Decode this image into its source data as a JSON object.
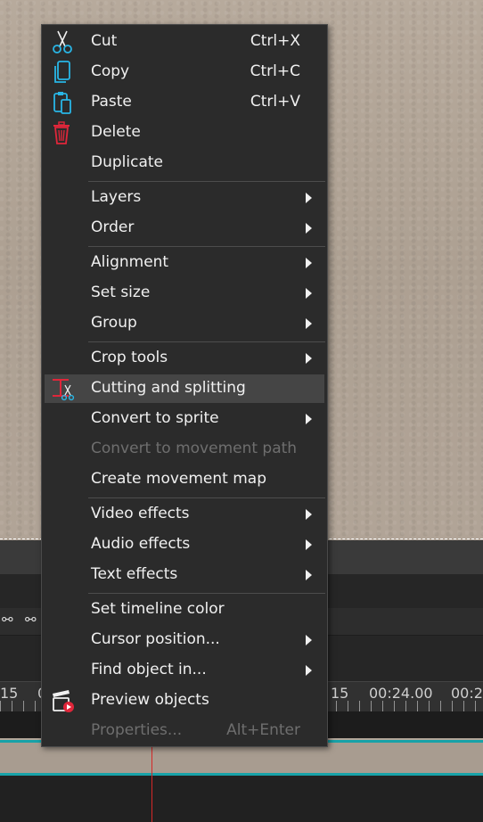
{
  "menu": {
    "items": [
      {
        "label": "Cut",
        "shortcut": "Ctrl+X",
        "icon": "scissors-icon"
      },
      {
        "label": "Copy",
        "shortcut": "Ctrl+C",
        "icon": "copy-icon"
      },
      {
        "label": "Paste",
        "shortcut": "Ctrl+V",
        "icon": "paste-icon"
      },
      {
        "label": "Delete",
        "icon": "trash-icon"
      },
      {
        "label": "Duplicate"
      },
      {
        "label": "Layers",
        "submenu": true
      },
      {
        "label": "Order",
        "submenu": true
      },
      {
        "label": "Alignment",
        "submenu": true
      },
      {
        "label": "Set size",
        "submenu": true
      },
      {
        "label": "Group",
        "submenu": true
      },
      {
        "label": "Crop tools",
        "submenu": true
      },
      {
        "label": "Cutting and splitting",
        "icon": "cut-split-icon",
        "highlighted": true
      },
      {
        "label": "Convert to sprite",
        "submenu": true
      },
      {
        "label": "Convert to movement path",
        "disabled": true
      },
      {
        "label": "Create movement map"
      },
      {
        "label": "Video effects",
        "submenu": true
      },
      {
        "label": "Audio effects",
        "submenu": true
      },
      {
        "label": "Text effects",
        "submenu": true
      },
      {
        "label": "Set timeline color"
      },
      {
        "label": "Cursor position...",
        "submenu": true
      },
      {
        "label": "Find object in...",
        "submenu": true
      },
      {
        "label": "Preview objects",
        "icon": "preview-clapper-icon"
      },
      {
        "label": "Properties...",
        "shortcut": "Alt+Enter",
        "disabled": true
      }
    ]
  },
  "timeline": {
    "ruler_left": "15",
    "ruler_left2": "0",
    "ruler_mid": "15",
    "ruler_time": "00:24.00",
    "ruler_right": "00:2"
  },
  "colors": {
    "menu_bg": "#2b2b2b",
    "highlight": "#454545",
    "icon_cyan": "#29b6e6",
    "icon_red": "#e0263a",
    "clip_teal": "#17a2a8",
    "cursor_red": "#d62828"
  }
}
